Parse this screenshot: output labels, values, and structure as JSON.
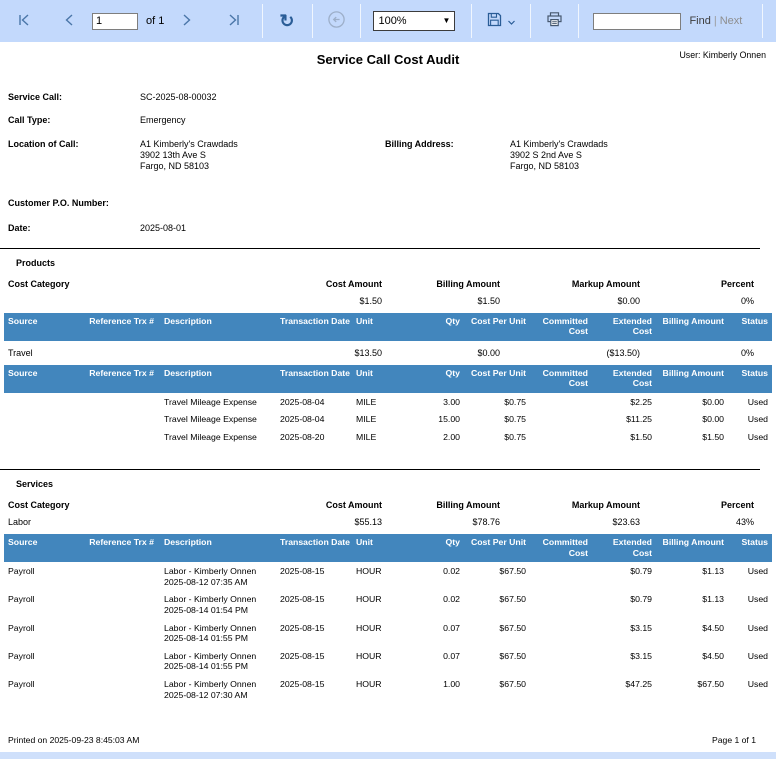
{
  "colors": {
    "toolbar_bg": "#c3d9fc",
    "table_header_bg": "#4286bd"
  },
  "icons": {
    "refresh": "↻",
    "zoom_caret": "▼",
    "find_next_divider": "|"
  },
  "toolbar": {
    "page_input_value": "1",
    "of_pages_label": "of 1",
    "zoom_value": "100%",
    "find_input_value": "",
    "find_label": "Find",
    "find_next_divider": "|",
    "next_label": "Next"
  },
  "report": {
    "title": "Service Call Cost Audit",
    "user_label": "User: Kimberly Onnen",
    "fields": {
      "service_call": {
        "label": "Service Call:",
        "value": "SC-2025-08-00032"
      },
      "call_type": {
        "label": "Call Type:",
        "value": "Emergency"
      },
      "location": {
        "label": "Location of Call:",
        "lines": [
          "A1 Kimberly's Crawdads",
          "3902 13th Ave S",
          "Fargo, ND 58103"
        ]
      },
      "billing_address": {
        "label": "Billing Address:",
        "lines": [
          "A1 Kimberly's Crawdads",
          "3902 S 2nd Ave S",
          "Fargo, ND 58103"
        ]
      },
      "customer_po": {
        "label": "Customer P.O. Number:",
        "value": ""
      },
      "date": {
        "label": "Date:",
        "value": "2025-08-01"
      }
    },
    "sections": [
      {
        "name": "Products",
        "summary_columns": [
          "Cost Category",
          "Cost Amount",
          "Billing Amount",
          "Markup Amount",
          "Percent"
        ],
        "detail_columns": [
          "Source",
          "Reference Trx #",
          "Description",
          "Transaction Date",
          "Unit",
          "Qty",
          "Cost Per Unit",
          "Committed Cost",
          "Extended Cost",
          "Billing Amount",
          "Status"
        ],
        "rows": [
          {
            "type": "summary",
            "category": "",
            "cost_amount": "$1.50",
            "billing_amount": "$1.50",
            "markup_amount": "$0.00",
            "percent": "0%"
          },
          {
            "type": "detail_header"
          },
          {
            "type": "summary",
            "category": "Travel",
            "cost_amount": "$13.50",
            "billing_amount": "$0.00",
            "markup_amount": "($13.50)",
            "percent": "0%"
          },
          {
            "type": "detail_header"
          },
          {
            "type": "detail",
            "source": "",
            "reference_trx": "",
            "description_lines": [
              "Travel Mileage Expense"
            ],
            "transaction_date": "2025-08-04",
            "unit": "MILE",
            "qty": "3.00",
            "cost_per_unit": "$0.75",
            "committed_cost": "",
            "extended_cost": "$2.25",
            "billing_amount": "$0.00",
            "status": "Used"
          },
          {
            "type": "detail",
            "source": "",
            "reference_trx": "",
            "description_lines": [
              "Travel Mileage Expense"
            ],
            "transaction_date": "2025-08-04",
            "unit": "MILE",
            "qty": "15.00",
            "cost_per_unit": "$0.75",
            "committed_cost": "",
            "extended_cost": "$11.25",
            "billing_amount": "$0.00",
            "status": "Used"
          },
          {
            "type": "detail",
            "source": "",
            "reference_trx": "",
            "description_lines": [
              "Travel Mileage Expense"
            ],
            "transaction_date": "2025-08-20",
            "unit": "MILE",
            "qty": "2.00",
            "cost_per_unit": "$0.75",
            "committed_cost": "",
            "extended_cost": "$1.50",
            "billing_amount": "$1.50",
            "status": "Used"
          }
        ]
      },
      {
        "name": "Services",
        "summary_columns": [
          "Cost Category",
          "Cost Amount",
          "Billing Amount",
          "Markup Amount",
          "Percent"
        ],
        "detail_columns": [
          "Source",
          "Reference Trx #",
          "Description",
          "Transaction Date",
          "Unit",
          "Qty",
          "Cost Per Unit",
          "Committed Cost",
          "Extended Cost",
          "Billing Amount",
          "Status"
        ],
        "rows": [
          {
            "type": "summary",
            "category": "Labor",
            "cost_amount": "$55.13",
            "billing_amount": "$78.76",
            "markup_amount": "$23.63",
            "percent": "43%"
          },
          {
            "type": "detail_header"
          },
          {
            "type": "detail",
            "source": "Payroll",
            "reference_trx": "",
            "description_lines": [
              "Labor - Kimberly Onnen",
              "2025-08-12 07:35 AM"
            ],
            "transaction_date": "2025-08-15",
            "unit": "HOUR",
            "qty": "0.02",
            "cost_per_unit": "$67.50",
            "committed_cost": "",
            "extended_cost": "$0.79",
            "billing_amount": "$1.13",
            "status": "Used"
          },
          {
            "type": "detail",
            "source": "Payroll",
            "reference_trx": "",
            "description_lines": [
              "Labor - Kimberly Onnen",
              "2025-08-14 01:54 PM"
            ],
            "transaction_date": "2025-08-15",
            "unit": "HOUR",
            "qty": "0.02",
            "cost_per_unit": "$67.50",
            "committed_cost": "",
            "extended_cost": "$0.79",
            "billing_amount": "$1.13",
            "status": "Used"
          },
          {
            "type": "detail",
            "source": "Payroll",
            "reference_trx": "",
            "description_lines": [
              "Labor - Kimberly Onnen",
              "2025-08-14 01:55 PM"
            ],
            "transaction_date": "2025-08-15",
            "unit": "HOUR",
            "qty": "0.07",
            "cost_per_unit": "$67.50",
            "committed_cost": "",
            "extended_cost": "$3.15",
            "billing_amount": "$4.50",
            "status": "Used"
          },
          {
            "type": "detail",
            "source": "Payroll",
            "reference_trx": "",
            "description_lines": [
              "Labor - Kimberly Onnen",
              "2025-08-14 01:55 PM"
            ],
            "transaction_date": "2025-08-15",
            "unit": "HOUR",
            "qty": "0.07",
            "cost_per_unit": "$67.50",
            "committed_cost": "",
            "extended_cost": "$3.15",
            "billing_amount": "$4.50",
            "status": "Used"
          },
          {
            "type": "detail",
            "source": "Payroll",
            "reference_trx": "",
            "description_lines": [
              "Labor - Kimberly Onnen",
              "2025-08-12 07:30 AM"
            ],
            "transaction_date": "2025-08-15",
            "unit": "HOUR",
            "qty": "1.00",
            "cost_per_unit": "$67.50",
            "committed_cost": "",
            "extended_cost": "$47.25",
            "billing_amount": "$67.50",
            "status": "Used"
          }
        ]
      }
    ],
    "footer": {
      "printed": "Printed on 2025-09-23 8:45:03 AM",
      "page": "Page 1 of 1"
    }
  }
}
